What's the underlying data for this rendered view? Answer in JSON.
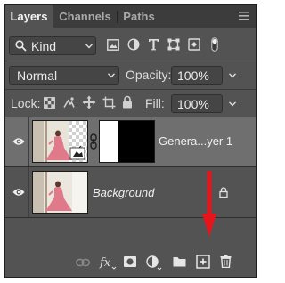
{
  "tabs": [
    {
      "label": "Layers",
      "active": true
    },
    {
      "label": "Channels",
      "active": false
    },
    {
      "label": "Paths",
      "active": false
    }
  ],
  "filter": {
    "label": "Kind"
  },
  "blend_mode": {
    "value": "Normal"
  },
  "opacity": {
    "label": "Opacity:",
    "value": "100%"
  },
  "lock": {
    "label": "Lock:"
  },
  "fill": {
    "label": "Fill:",
    "value": "100%"
  },
  "layers": [
    {
      "name": "Genera...yer 1",
      "selected": true,
      "has_mask": true
    },
    {
      "name": "Background",
      "selected": false,
      "locked": true
    }
  ],
  "footer_icons": [
    "link-icon",
    "fx-icon",
    "mask-icon",
    "adjustment-icon",
    "group-folder-icon",
    "new-layer-icon",
    "trash-icon"
  ],
  "colors": {
    "panel": "#535353",
    "tabbar": "#3c3c3c",
    "selected_row": "#6f6f6f",
    "arrow": "#e8141b"
  }
}
